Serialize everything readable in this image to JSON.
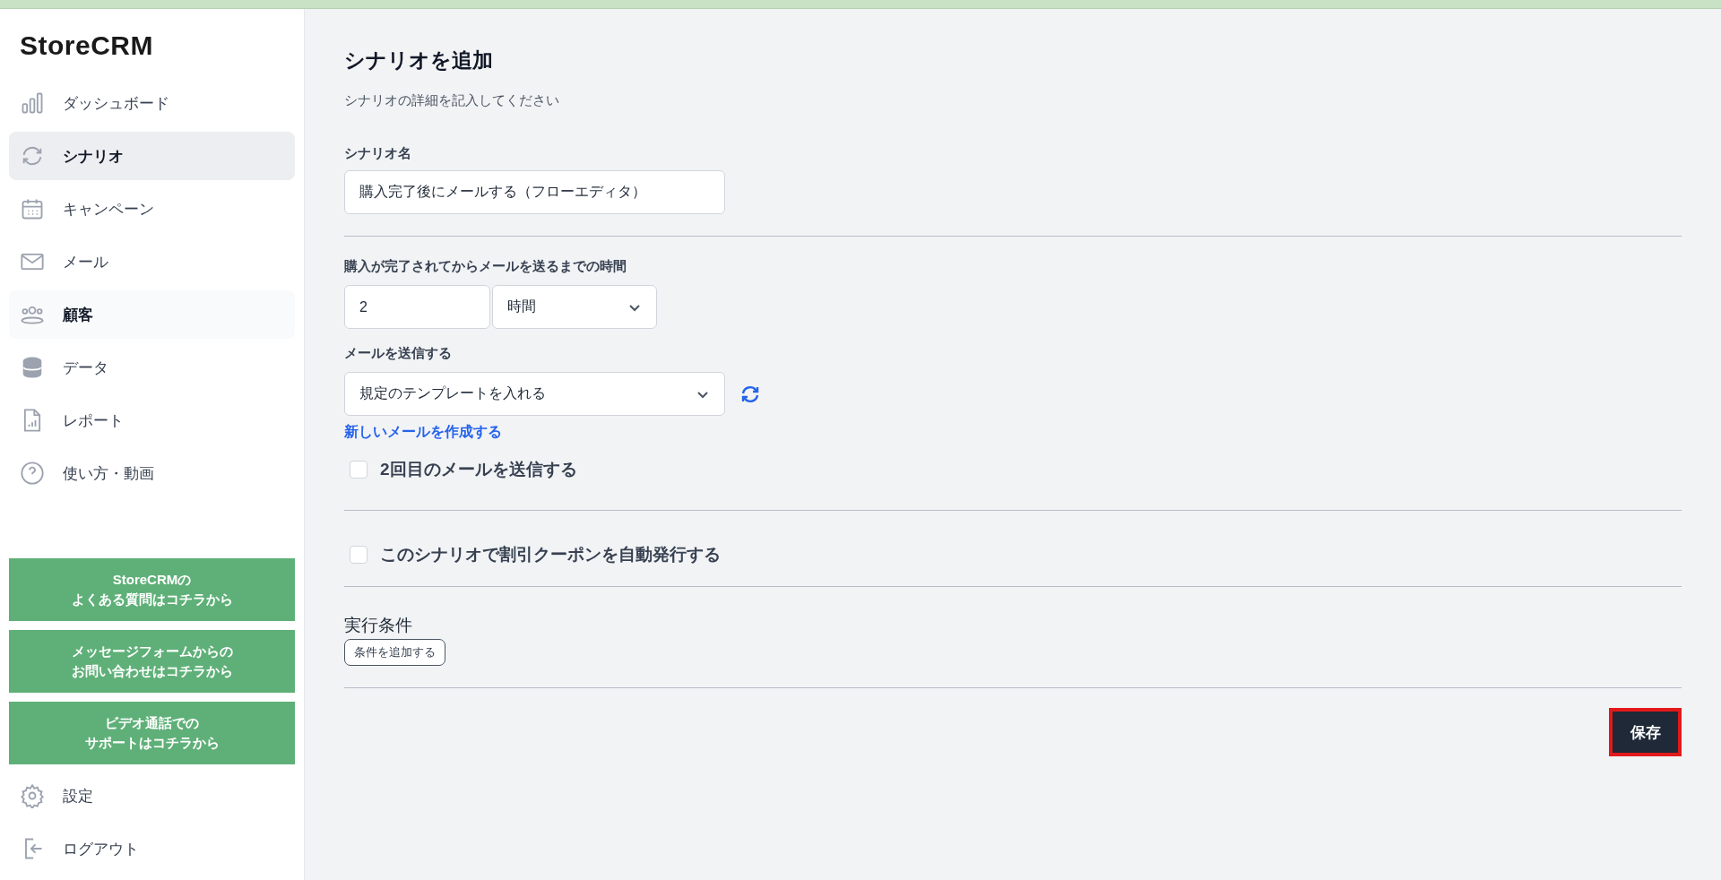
{
  "sidebar": {
    "logo": "StoreCRM",
    "items": [
      {
        "label": "ダッシュボード",
        "kind": "chart",
        "selected": false,
        "hovered": false
      },
      {
        "label": "シナリオ",
        "kind": "cycle",
        "selected": true,
        "hovered": false
      },
      {
        "label": "キャンペーン",
        "kind": "calendar",
        "selected": false,
        "hovered": false
      },
      {
        "label": "メール",
        "kind": "mail",
        "selected": false,
        "hovered": false
      },
      {
        "label": "顧客",
        "kind": "users",
        "selected": false,
        "hovered": true
      },
      {
        "label": "データ",
        "kind": "database",
        "selected": false,
        "hovered": false
      },
      {
        "label": "レポート",
        "kind": "report",
        "selected": false,
        "hovered": false
      },
      {
        "label": "使い方・動画",
        "kind": "help",
        "selected": false,
        "hovered": false
      }
    ],
    "support_buttons": [
      [
        "StoreCRMの",
        "よくある質問はコチラから"
      ],
      [
        "メッセージフォームからの",
        "お問い合わせはコチラから"
      ],
      [
        "ビデオ通話での",
        "サポートはコチラから"
      ]
    ],
    "bottom_items": [
      {
        "label": "設定",
        "kind": "gear"
      },
      {
        "label": "ログアウト",
        "kind": "logout"
      }
    ]
  },
  "main": {
    "title": "シナリオを追加",
    "subtitle": "シナリオの詳細を記入してください",
    "name_label": "シナリオ名",
    "name_value": "購入完了後にメールする（フローエディタ）",
    "delay_label": "購入が完了されてからメールを送るまでの時間",
    "delay_value": "2",
    "delay_unit": "時間",
    "mail_label": "メールを送信する",
    "mail_template": "規定のテンプレートを入れる",
    "new_mail_link": "新しいメールを作成する",
    "second_mail": {
      "label": "2回目のメールを送信する",
      "checked": false
    },
    "coupon": {
      "label": "このシナリオで割引クーポンを自動発行する",
      "checked": false
    },
    "conditions_label": "実行条件",
    "add_condition_button": "条件を追加する",
    "save_button": "保存"
  }
}
